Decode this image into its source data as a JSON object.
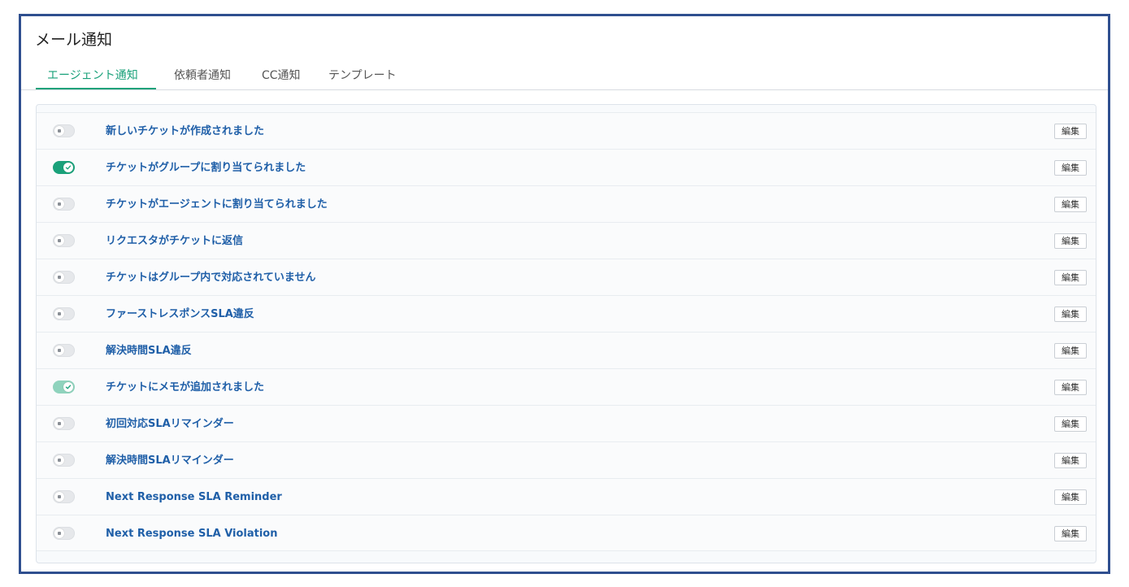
{
  "page": {
    "title": "メール通知"
  },
  "tabs": [
    {
      "label": "エージェント通知",
      "active": true
    },
    {
      "label": "依頼者通知",
      "active": false
    },
    {
      "label": "CC通知",
      "active": false
    },
    {
      "label": "テンプレート",
      "active": false
    }
  ],
  "notifications": [
    {
      "label": "新しいチケットが作成されました",
      "enabled": false,
      "edit_label": "編集"
    },
    {
      "label": "チケットがグループに割り当てられました",
      "enabled": true,
      "edit_label": "編集"
    },
    {
      "label": "チケットがエージェントに割り当てられました",
      "enabled": false,
      "edit_label": "編集"
    },
    {
      "label": "リクエスタがチケットに返信",
      "enabled": false,
      "edit_label": "編集"
    },
    {
      "label": "チケットはグループ内で対応されていません",
      "enabled": false,
      "edit_label": "編集"
    },
    {
      "label": "ファーストレスポンスSLA違反",
      "enabled": false,
      "edit_label": "編集"
    },
    {
      "label": "解決時間SLA違反",
      "enabled": false,
      "edit_label": "編集"
    },
    {
      "label": "チケットにメモが追加されました",
      "enabled": true,
      "faded": true,
      "edit_label": "編集"
    },
    {
      "label": "初回対応SLAリマインダー",
      "enabled": false,
      "edit_label": "編集"
    },
    {
      "label": "解決時間SLAリマインダー",
      "enabled": false,
      "edit_label": "編集"
    },
    {
      "label": "Next Response SLA Reminder",
      "enabled": false,
      "edit_label": "編集"
    },
    {
      "label": "Next Response SLA Violation",
      "enabled": false,
      "edit_label": "編集"
    }
  ],
  "colors": {
    "accent": "#1aa17a",
    "link": "#1f5fa8",
    "frame": "#2f4f8f"
  }
}
